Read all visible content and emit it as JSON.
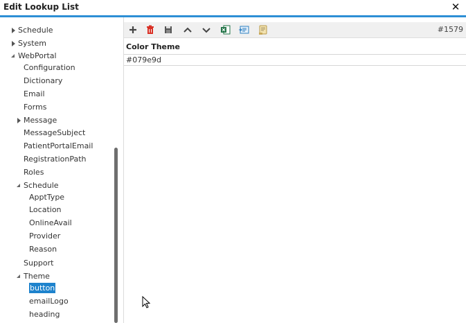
{
  "window": {
    "title": "Edit Lookup List",
    "close_glyph": "✕"
  },
  "tree": {
    "items": [
      {
        "label": "Schedule",
        "level": 0,
        "state": "collapsed"
      },
      {
        "label": "System",
        "level": 0,
        "state": "collapsed"
      },
      {
        "label": "WebPortal",
        "level": 0,
        "state": "expanded"
      },
      {
        "label": "Configuration",
        "level": 1,
        "state": "leaf"
      },
      {
        "label": "Dictionary",
        "level": 1,
        "state": "leaf"
      },
      {
        "label": "Email",
        "level": 1,
        "state": "leaf"
      },
      {
        "label": "Forms",
        "level": 1,
        "state": "leaf"
      },
      {
        "label": "Message",
        "level": 1,
        "state": "collapsed"
      },
      {
        "label": "MessageSubject",
        "level": 1,
        "state": "leaf"
      },
      {
        "label": "PatientPortalEmail",
        "level": 1,
        "state": "leaf"
      },
      {
        "label": "RegistrationPath",
        "level": 1,
        "state": "leaf"
      },
      {
        "label": "Roles",
        "level": 1,
        "state": "leaf"
      },
      {
        "label": "Schedule",
        "level": 1,
        "state": "expanded"
      },
      {
        "label": "ApptType",
        "level": 2,
        "state": "leaf"
      },
      {
        "label": "Location",
        "level": 2,
        "state": "leaf"
      },
      {
        "label": "OnlineAvail",
        "level": 2,
        "state": "leaf"
      },
      {
        "label": "Provider",
        "level": 2,
        "state": "leaf"
      },
      {
        "label": "Reason",
        "level": 2,
        "state": "leaf"
      },
      {
        "label": "Support",
        "level": 1,
        "state": "leaf"
      },
      {
        "label": "Theme",
        "level": 1,
        "state": "expanded"
      },
      {
        "label": "button",
        "level": 2,
        "state": "leaf",
        "selected": true
      },
      {
        "label": "emailLogo",
        "level": 2,
        "state": "leaf"
      },
      {
        "label": "heading",
        "level": 2,
        "state": "leaf"
      }
    ]
  },
  "toolbar": {
    "buttons": [
      {
        "name": "add",
        "icon": "plus-icon"
      },
      {
        "name": "delete",
        "icon": "trash-icon"
      },
      {
        "name": "save",
        "icon": "save-icon"
      },
      {
        "name": "move-up",
        "icon": "chevron-up-icon"
      },
      {
        "name": "move-down",
        "icon": "chevron-down-icon"
      },
      {
        "name": "export-excel",
        "icon": "excel-icon"
      },
      {
        "name": "import",
        "icon": "import-icon"
      },
      {
        "name": "script",
        "icon": "scroll-icon"
      }
    ],
    "record_id": "#1579"
  },
  "grid": {
    "column_header": "Color Theme",
    "rows": [
      {
        "value": "#079e9d"
      }
    ]
  },
  "colors": {
    "accent": "#2d8fd5",
    "selection": "#1e83cd",
    "delete_icon": "#d93025",
    "excel_icon": "#217346"
  }
}
